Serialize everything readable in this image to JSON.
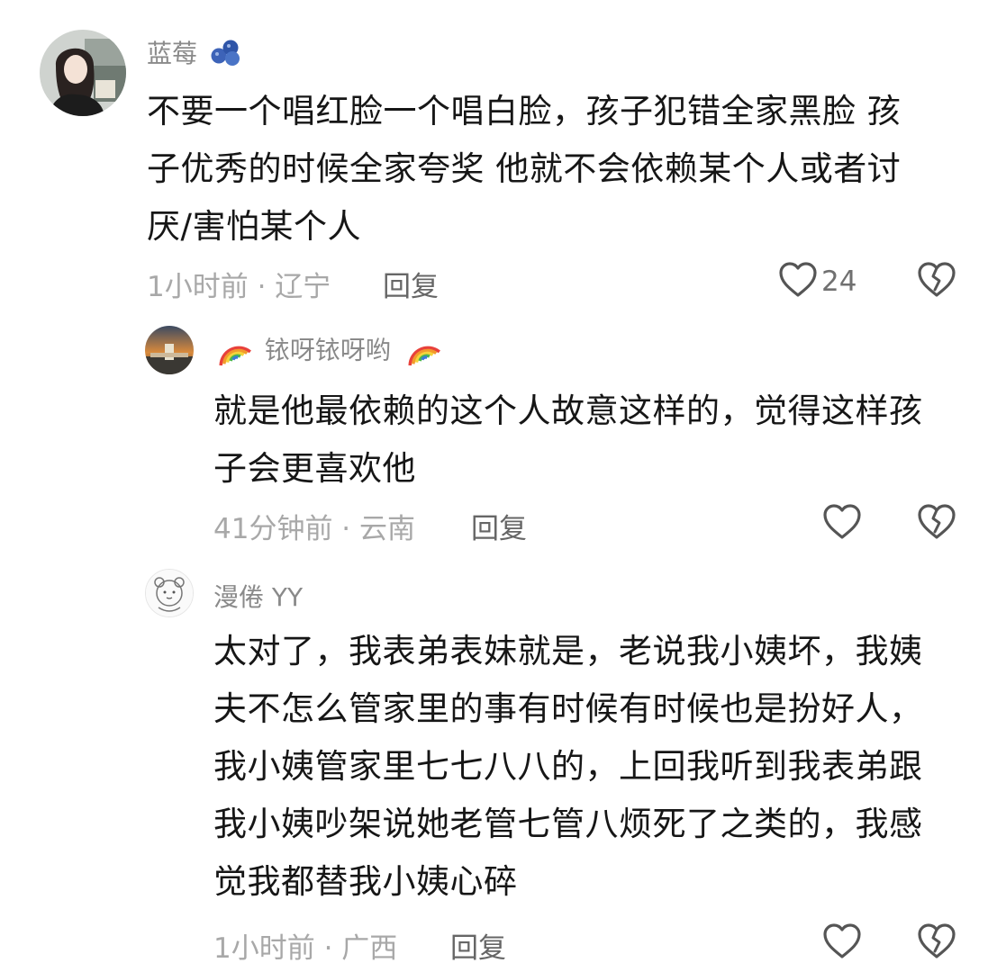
{
  "comments": [
    {
      "username": "蓝莓",
      "badge_icon": "blueberry-icon",
      "text_lines": [
        "不要一个唱红脸一个唱白脸，孩子犯错全家黑脸 孩",
        "子优秀的时候全家夸奖 他就不会依赖某个人或者讨",
        "厌/害怕某个人"
      ],
      "time": "1小时前",
      "location": "辽宁",
      "meta": "1小时前 · 辽宁",
      "reply_label": "回复",
      "like_count": "24",
      "like_icon": "heart-outline-icon",
      "dislike_icon": "broken-heart-icon"
    },
    {
      "username": "铱呀铱呀哟",
      "name_decoration_icon": "rainbow-icon",
      "text_lines": [
        "就是他最依赖的这个人故意这样的，觉得这样孩",
        "子会更喜欢他"
      ],
      "time": "41分钟前",
      "location": "云南",
      "meta": "41分钟前 · 云南",
      "reply_label": "回复",
      "like_icon": "heart-outline-icon",
      "dislike_icon": "broken-heart-icon"
    },
    {
      "username": "漫倦 YY",
      "text_lines": [
        "太对了，我表弟表妹就是，老说我小姨坏，我姨",
        "夫不怎么管家里的事有时候有时候也是扮好人，",
        "我小姨管家里七七八八的，上回我听到我表弟跟",
        "我小姨吵架说她老管七管八烦死了之类的，我感",
        "觉我都替我小姨心碎"
      ],
      "time": "1小时前",
      "location": "广西",
      "meta": "1小时前 · 广西",
      "reply_label": "回复",
      "like_icon": "heart-outline-icon",
      "dislike_icon": "broken-heart-icon"
    }
  ],
  "colors": {
    "text": "#161616",
    "username": "#8a8a8a",
    "meta": "#a8a8a8",
    "reply": "#666666",
    "icon": "#555555"
  }
}
